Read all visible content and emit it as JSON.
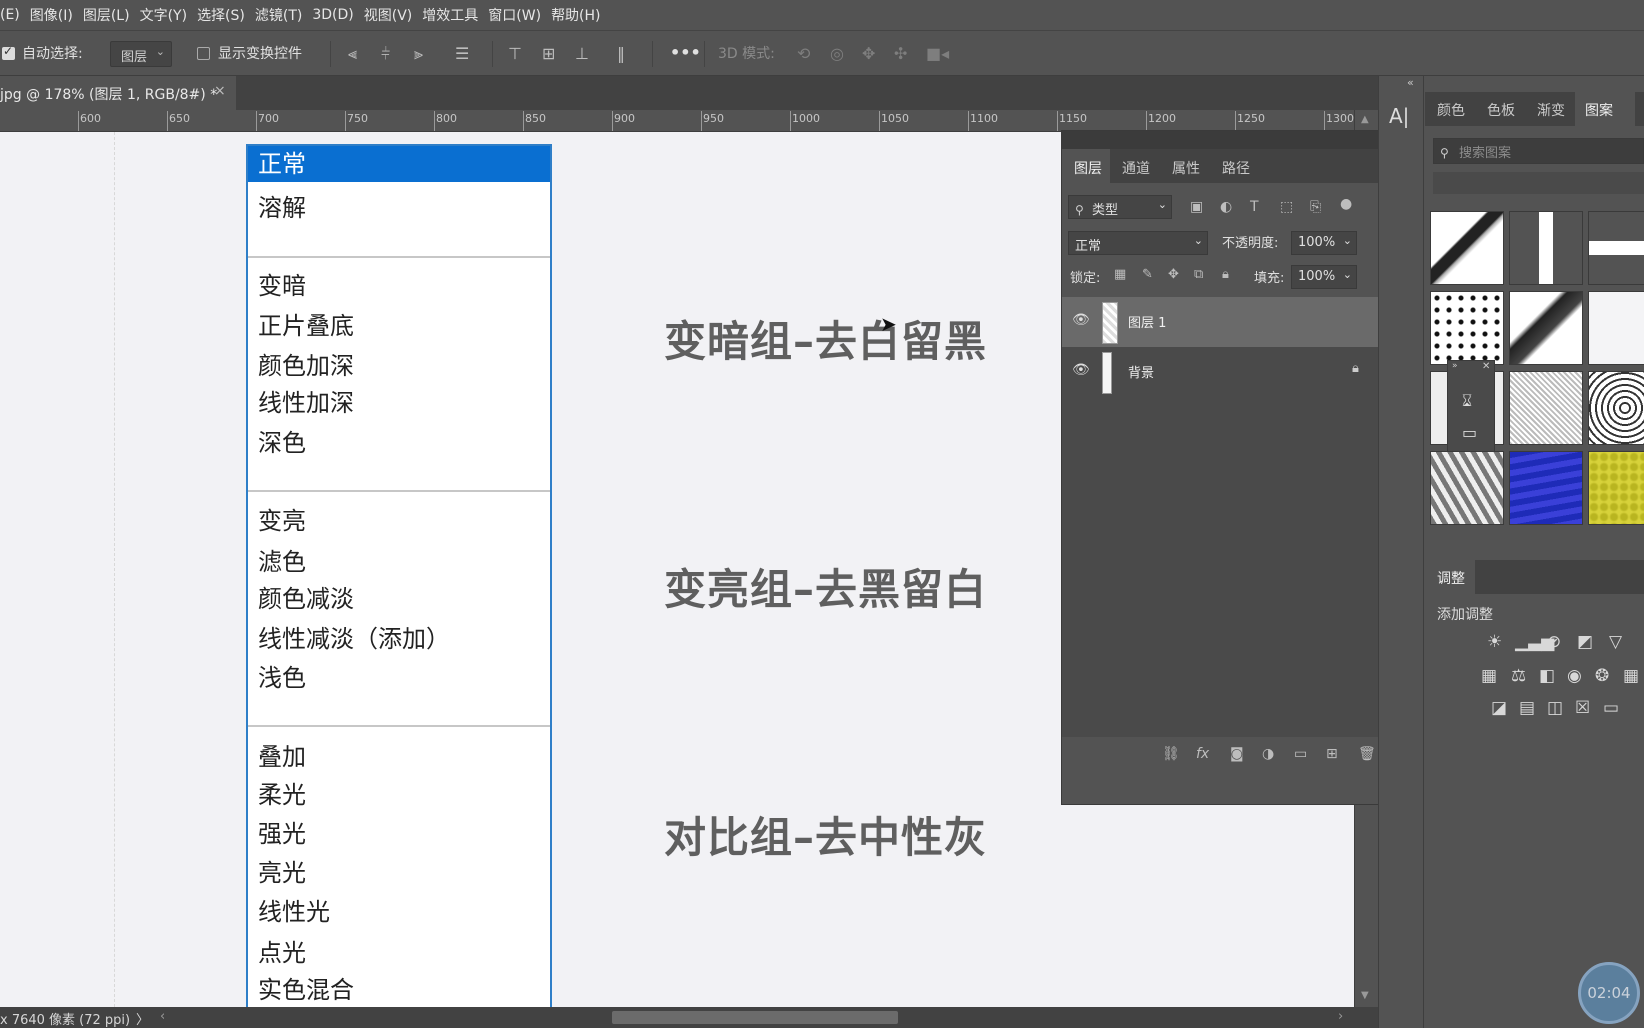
{
  "menu": [
    "(E)",
    "图像(I)",
    "图层(L)",
    "文字(Y)",
    "选择(S)",
    "滤镜(T)",
    "3D(D)",
    "视图(V)",
    "增效工具",
    "窗口(W)",
    "帮助(H)"
  ],
  "options": {
    "auto_select_label": "自动选择:",
    "auto_select_value": "图层",
    "show_transform_label": "显示变换控件",
    "more": "•••",
    "mode3d_label": "3D 模式:"
  },
  "doc_tab": {
    "title": "jpg @ 178% (图层 1, RGB/8#) *",
    "close": "×"
  },
  "ruler_ticks": [
    "600",
    "650",
    "700",
    "750",
    "800",
    "850",
    "900",
    "950",
    "1000",
    "1050",
    "1100",
    "1150",
    "1200",
    "1250",
    "1300"
  ],
  "canvas": {
    "blend_groups": [
      [
        "正常",
        "溶解"
      ],
      [
        "变暗",
        "正片叠底",
        "颜色加深",
        "线性加深",
        "深色"
      ],
      [
        "变亮",
        "滤色",
        "颜色减淡",
        "线性减淡（添加）",
        "浅色"
      ],
      [
        "叠加",
        "柔光",
        "强光",
        "亮光",
        "线性光",
        "点光",
        "实色混合"
      ]
    ],
    "headlines": [
      "变暗组–去白留黑",
      "变亮组–去黑留白",
      "对比组–去中性灰"
    ]
  },
  "status": {
    "text": "x 7640 像素 (72 ppi)",
    "arrow": "〉"
  },
  "layers_panel": {
    "tabs": [
      "图层",
      "通道",
      "属性",
      "路径"
    ],
    "filter_label": "类型",
    "blend_mode": "正常",
    "opacity_label": "不透明度:",
    "opacity_value": "100%",
    "lock_label": "锁定:",
    "fill_label": "填充:",
    "fill_value": "100%",
    "layers": [
      {
        "name": "图层 1",
        "selected": true
      },
      {
        "name": "背景",
        "locked": true
      }
    ],
    "footer_fx": "fx"
  },
  "right_panel": {
    "tabs": [
      "颜色",
      "色板",
      "渐变",
      "图案"
    ],
    "search_placeholder": "搜索图案",
    "adjust_tab": "调整",
    "add_adjust": "添加调整"
  },
  "timer": "02:04",
  "colors": {
    "accent": "#0a6fd1",
    "panel": "#535353",
    "dark": "#424242"
  }
}
